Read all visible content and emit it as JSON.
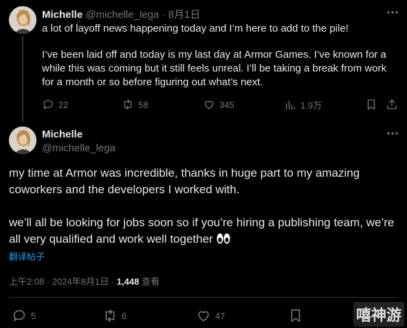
{
  "tweet1": {
    "author_name": "Michelle",
    "author_handle": "@michelle_lega",
    "separator": "·",
    "date": "8月1日",
    "text_line1": "a lot of layoff news happening today and I’m here to add to the pile!",
    "text_para2": "I’ve been laid off and today is my last day at Armor Games. I’ve known for a while this was coming but it still feels unreal. I’ll be taking a break from work for a month or so before figuring out what’s next.",
    "replies": "22",
    "reposts": "58",
    "likes": "345",
    "views": "1.9万"
  },
  "tweet2": {
    "author_name": "Michelle",
    "author_handle": "@michelle_lega",
    "para1": "my time at Armor was incredible, thanks in huge part to my amazing coworkers and the developers I worked with.",
    "para2": "we’ll all be looking for jobs soon so if you’re hiring a publishing team, we’re all very qualified and work well together",
    "translate_label": "翻译帖子",
    "timestamp": "上午2:08 · 2024年8月1日 · ",
    "views_count": "1,448",
    "views_label": " 查看",
    "replies": "5",
    "reposts": "6",
    "likes": "47"
  },
  "watermark": "嘻神游",
  "colors": {
    "background": "#000000",
    "text": "#e7e9ea",
    "muted": "#71767b",
    "link": "#1d9bf0",
    "divider": "#2f3336"
  },
  "icons": [
    "reply-icon",
    "repost-icon",
    "like-icon",
    "views-icon",
    "bookmark-icon",
    "share-icon",
    "more-icon",
    "eyes-emoji"
  ]
}
